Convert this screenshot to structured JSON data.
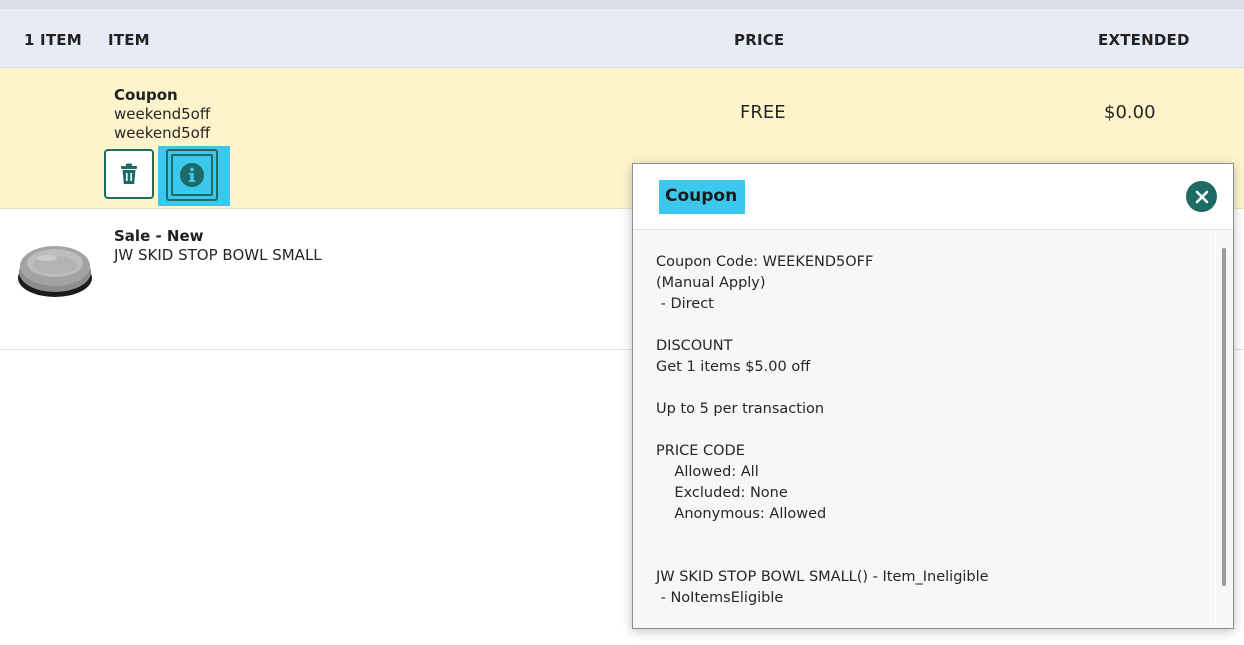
{
  "header": {
    "count_label": "1 ITEM",
    "item_label": "ITEM",
    "price_label": "PRICE",
    "extended_label": "EXTENDED"
  },
  "rows": [
    {
      "name": "Coupon",
      "lines": [
        "weekend5off",
        "weekend5off"
      ],
      "price": "FREE",
      "extended": "$0.00"
    },
    {
      "name": "Sale - New",
      "lines": [
        "JW SKID STOP BOWL SMALL"
      ]
    }
  ],
  "modal": {
    "title": "Coupon",
    "lines": [
      "Coupon Code: WEEKEND5OFF",
      "(Manual Apply)",
      " - Direct",
      "DISCOUNT",
      "Get 1 items $5.00 off",
      "Up to 5 per transaction",
      "PRICE CODE",
      "    Allowed: All",
      "    Excluded: None",
      "    Anonymous: Allowed",
      "JW SKID STOP BOWL SMALL() - Item_Ineligible",
      " - NoItemsEligible"
    ]
  },
  "icons": {
    "delete": "trash-icon",
    "info": "info-icon",
    "close": "close-icon",
    "product": "bowl-image"
  },
  "colors": {
    "accent": "#1e6b66",
    "highlight": "#3cc8ec",
    "coupon_row": "#fef4cc",
    "header_bg": "#e8ebf5"
  }
}
